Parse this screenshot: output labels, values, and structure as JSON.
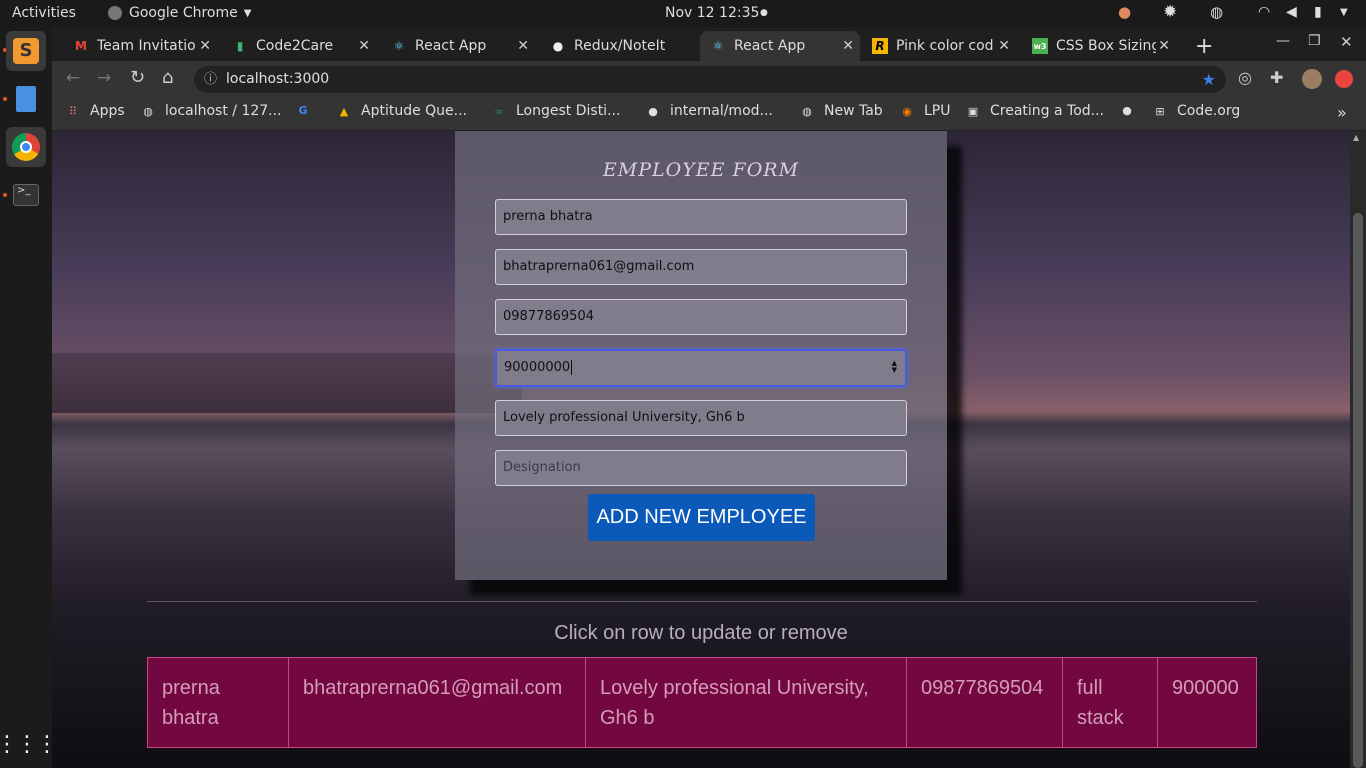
{
  "top_bar": {
    "activities": "Activities",
    "app_name": "Google Chrome",
    "clock": "Nov 12  12:35"
  },
  "tabs": [
    {
      "label": "Team Invitatio",
      "icon": "gmail-icon"
    },
    {
      "label": "Code2Care",
      "icon": "code2care-icon"
    },
    {
      "label": "React App",
      "icon": "react-icon"
    },
    {
      "label": "Redux/NoteIt",
      "icon": "github-icon"
    },
    {
      "label": "React App",
      "icon": "react-icon",
      "active": true
    },
    {
      "label": "Pink color cod",
      "icon": "r-icon"
    },
    {
      "label": "CSS Box Sizing",
      "icon": "w3-icon"
    }
  ],
  "address_bar": {
    "url": "localhost:3000"
  },
  "bookmarks": [
    {
      "label": "Apps",
      "icon": "apps-grid-icon"
    },
    {
      "label": "localhost / 127...",
      "icon": "globe-icon"
    },
    {
      "label": "",
      "icon": "google-icon"
    },
    {
      "label": "Aptitude Que...",
      "icon": "drive-icon"
    },
    {
      "label": "Longest Disti...",
      "icon": "gfg-icon"
    },
    {
      "label": "internal/mod...",
      "icon": "github-icon"
    },
    {
      "label": "New Tab",
      "icon": "globe-icon"
    },
    {
      "label": "LPU",
      "icon": "lpu-icon"
    },
    {
      "label": "Creating a Tod...",
      "icon": "video-icon"
    },
    {
      "label": "",
      "icon": "github-icon"
    },
    {
      "label": "Code.org",
      "icon": "codeorg-icon"
    }
  ],
  "form": {
    "title": "EMPLOYEE FORM",
    "name_value": "prerna bhatra",
    "email_value": "bhatraprerna061@gmail.com",
    "phone_value": "09877869504",
    "salary_value": "90000000",
    "address_value": "Lovely professional University, Gh6 b",
    "designation_placeholder": "Designation",
    "submit_label": "ADD NEW EMPLOYEE"
  },
  "table": {
    "hint": "Click on row to update or remove",
    "rows": [
      [
        "prerna bhatra",
        "bhatraprerna061@gmail.com",
        "Lovely professional University, Gh6 b",
        "09877869504",
        "full stack",
        "900000"
      ]
    ]
  },
  "colors": {
    "button": "#0b59b8",
    "row_bg": "#73073f",
    "row_border": "#c94586"
  }
}
